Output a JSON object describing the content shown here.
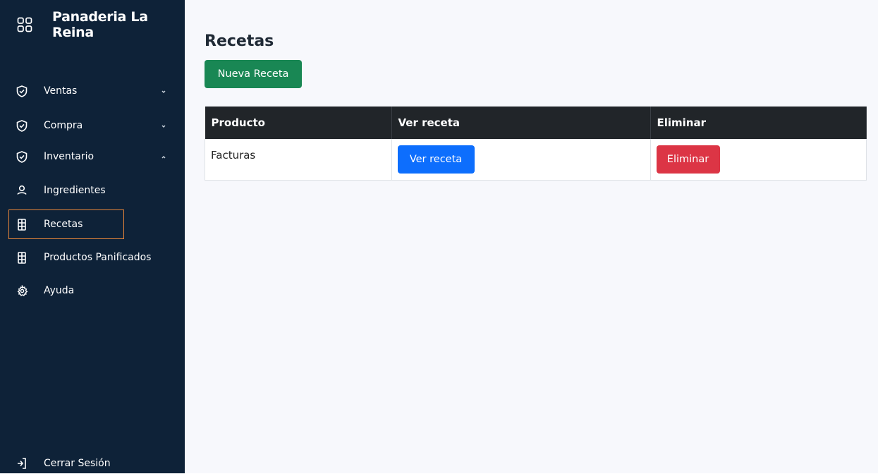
{
  "sidebar": {
    "brand": "Panaderia La Reina",
    "items": [
      {
        "label": "Ventas",
        "icon": "shield-check-icon",
        "chevron": "down"
      },
      {
        "label": "Compra",
        "icon": "shield-check-icon",
        "chevron": "down"
      },
      {
        "label": "Inventario",
        "icon": "shield-check-icon",
        "chevron": "up"
      },
      {
        "label": "Ingredientes",
        "icon": "user-icon"
      },
      {
        "label": "Recetas",
        "icon": "building-icon",
        "active": true
      },
      {
        "label": "Productos Panificados",
        "icon": "building-icon"
      },
      {
        "label": "Ayuda",
        "icon": "gear-icon"
      }
    ],
    "logout": "Cerrar Sesión",
    "active_color": "#e8863a"
  },
  "main": {
    "title": "Recetas",
    "new_button": "Nueva Receta",
    "table": {
      "headers": [
        "Producto",
        "Ver receta",
        "Eliminar"
      ],
      "rows": [
        {
          "producto": "Facturas",
          "view_label": "Ver receta",
          "delete_label": "Eliminar"
        }
      ]
    }
  }
}
